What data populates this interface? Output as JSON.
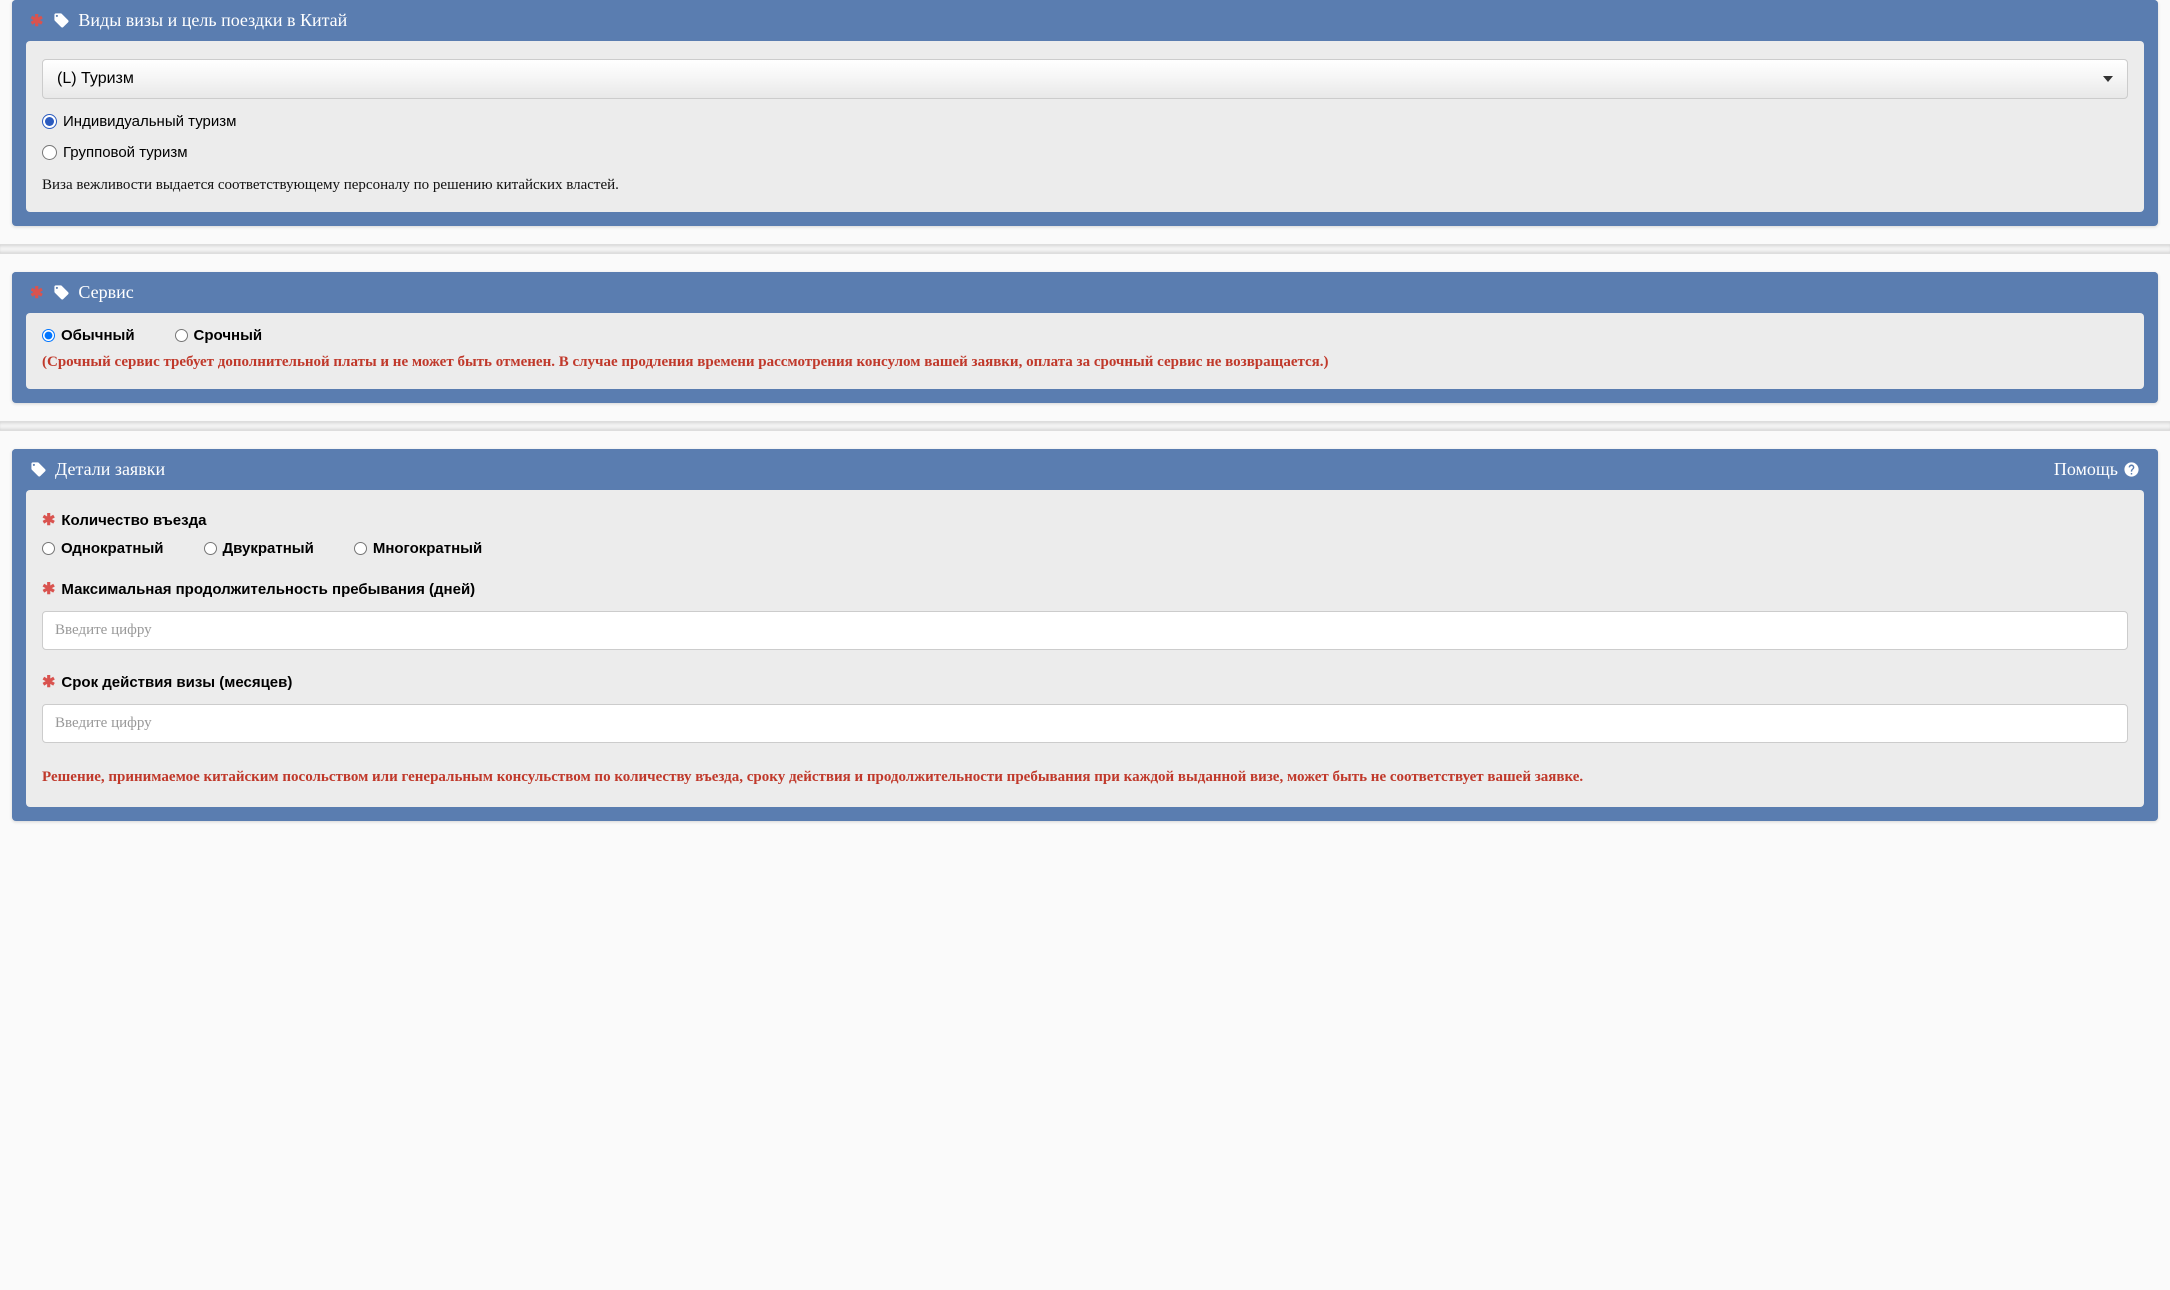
{
  "section1": {
    "title": "Виды визы и цель поездки в Китай",
    "dropdown_value": "(L) Туризм",
    "radios": {
      "individual": "Индивидуальный туризм",
      "group": "Групповой туризм"
    },
    "note": "Виза вежливости выдается соответствующему персоналу по решению китайских властей."
  },
  "section2": {
    "title": "Сервис",
    "radios": {
      "regular": "Обычный",
      "urgent": "Срочный"
    },
    "warning": "(Срочный сервис требует дополнительной платы и не может быть отменен. В случае продления времени рассмотрения консулом вашей заявки, оплата за срочный сервис не возвращается.)"
  },
  "section3": {
    "title": "Детали заявки",
    "help_label": "Помощь",
    "entries_label": "Количество въезда",
    "entries_radios": {
      "single": "Однократный",
      "double": "Двукратный",
      "multiple": "Многократный"
    },
    "max_stay_label": "Максимальная продолжительность пребывания (дней)",
    "max_stay_placeholder": "Введите цифру",
    "validity_label": "Срок действия визы (месяцев)",
    "validity_placeholder": "Введите цифру",
    "disclaimer": "Решение, принимаемое китайским посольством или генеральным консульством по количеству въезда, сроку действия и продолжительности пребывания при каждой выданной визе, может быть не соответствует вашей заявке."
  }
}
